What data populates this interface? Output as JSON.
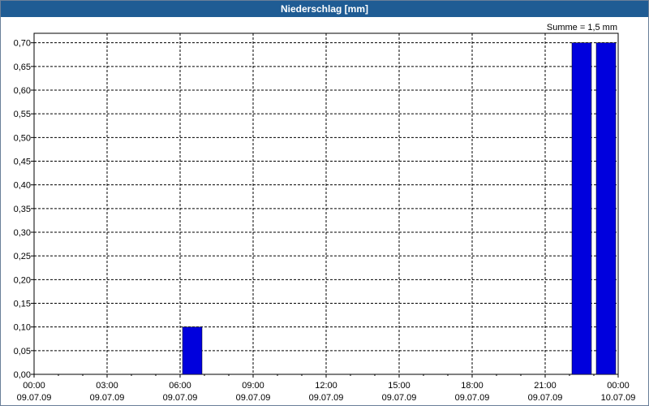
{
  "window": {
    "title": "Niederschlag [mm]"
  },
  "annotation": {
    "sum": "Summe = 1,5 mm"
  },
  "colors": {
    "bar": "#0000dd",
    "title_bar": "#1f5c94",
    "grid": "#000000"
  },
  "chart_data": {
    "type": "bar",
    "title": "Niederschlag [mm]",
    "xlabel": "",
    "ylabel": "",
    "grid": true,
    "ylim": [
      0,
      0.72
    ],
    "xlim": [
      "09.07.09 00:00",
      "10.07.09 00:00"
    ],
    "y_ticks": [
      "0,00",
      "0,05",
      "0,10",
      "0,15",
      "0,20",
      "0,25",
      "0,30",
      "0,35",
      "0,40",
      "0,45",
      "0,50",
      "0,55",
      "0,60",
      "0,65",
      "0,70"
    ],
    "x_ticks": [
      {
        "time": "00:00",
        "date": "09.07.09"
      },
      {
        "time": "03:00",
        "date": "09.07.09"
      },
      {
        "time": "06:00",
        "date": "09.07.09"
      },
      {
        "time": "09:00",
        "date": "09.07.09"
      },
      {
        "time": "12:00",
        "date": "09.07.09"
      },
      {
        "time": "15:00",
        "date": "09.07.09"
      },
      {
        "time": "18:00",
        "date": "09.07.09"
      },
      {
        "time": "21:00",
        "date": "09.07.09"
      },
      {
        "time": "00:00",
        "date": "10.07.09"
      }
    ],
    "bars": [
      {
        "start": "09.07.09 06:00",
        "end": "09.07.09 07:00",
        "value": 0.1
      },
      {
        "start": "09.07.09 22:00",
        "end": "09.07.09 23:00",
        "value": 0.7
      },
      {
        "start": "09.07.09 23:00",
        "end": "10.07.09 00:00",
        "value": 0.7
      }
    ]
  }
}
